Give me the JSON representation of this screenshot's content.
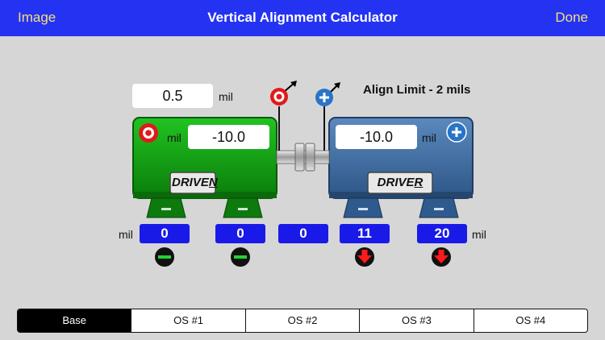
{
  "nav": {
    "left_label": "Image",
    "title": "Vertical Alignment Calculator",
    "right_label": "Done"
  },
  "inputs": {
    "top_value": "0.5",
    "driven_value": "-10.0",
    "driver_value": "-10.0",
    "unit": "mil"
  },
  "align_limit": "Align Limit - 2 mils",
  "motors": {
    "driven_label": "DRIVEN",
    "driver_label": "DRIVER"
  },
  "readouts": {
    "unit": "mil",
    "values": [
      "0",
      "0",
      "0",
      "11",
      "20"
    ]
  },
  "tabs": [
    "Base",
    "OS #1",
    "OS #2",
    "OS #3",
    "OS #4"
  ],
  "colors": {
    "nav_bg": "#2433f2",
    "nav_text": "#f4e07a",
    "driven_motor": "#0f9a0f",
    "driver_motor": "#3f6ea3",
    "readout_bg": "#1a1ae8",
    "indicator_ok": "#22d433",
    "indicator_down": "#ff1a1a"
  }
}
